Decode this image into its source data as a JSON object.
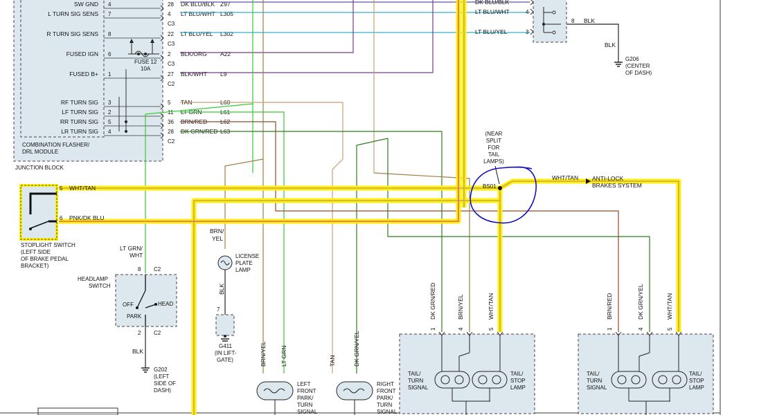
{
  "colors": {
    "highlight": "#fff200",
    "wht_tan": "#c8a070",
    "pnk_dk_blu": "#e85a8a",
    "lt_grn": "#33cc33",
    "brn_yel": "#a08040",
    "dk_grn_yel": "#2e7d1f",
    "brn_red": "#8b4a2a",
    "lt_blu": "#30b0d0",
    "circle_mark": "#1010c0"
  },
  "junction_block": {
    "title": "JUNCTION BLOCK",
    "module": {
      "line1": "COMBINATION FLASHER/",
      "line2": "DRL MODULE"
    },
    "rows": [
      {
        "label": "SW GND",
        "pin": "4",
        "cpin": "28",
        "wire": "DK BLU/BLK",
        "circuit": "Z97",
        "conn": ""
      },
      {
        "label": "L TURN SIG SENS",
        "pin": "7",
        "cpin": "4",
        "wire": "LT BLU/WHT",
        "circuit": "L305",
        "conn": "C3"
      },
      {
        "label": "R TURN SIG SENS",
        "pin": "8",
        "cpin": "22",
        "wire": "LT BLU/YEL",
        "circuit": "L302",
        "conn": "C3"
      },
      {
        "label": "FUSED IGN",
        "pin": "6",
        "cpin": "2",
        "wire": "BLK/ORG",
        "circuit": "A22",
        "conn": "C3"
      },
      {
        "label": "FUSED B+",
        "pin": "1",
        "cpin": "27",
        "wire": "BLK/WHT",
        "circuit": "L9",
        "conn": "C2"
      },
      {
        "label": "RF TURN SIG",
        "pin": "3",
        "cpin": "5",
        "wire": "TAN",
        "circuit": "L60",
        "conn": ""
      },
      {
        "label": "LF TURN SIG",
        "pin": "2",
        "cpin": "11",
        "wire": "LT GRN",
        "circuit": "L61",
        "conn": ""
      },
      {
        "label": "RR TURN SIG",
        "pin": "5",
        "cpin": "36",
        "wire": "BRN/RED",
        "circuit": "L62",
        "conn": ""
      },
      {
        "label": "LR TURN SIG",
        "pin": "4",
        "cpin": "28",
        "wire": "DK GRN/RED",
        "circuit": "L63",
        "conn": "C2"
      }
    ],
    "fuse": {
      "name": "FUSE 12",
      "rating": "10A"
    }
  },
  "right_switch": {
    "rows": [
      {
        "wire": "DK BLU/BLK",
        "pin": ""
      },
      {
        "wire": "LT BLU/WHT",
        "pin": "4"
      },
      {
        "wire": "LT BLU/YEL",
        "pin": "3"
      }
    ],
    "out_pin": "8",
    "out_wire": "BLK",
    "ground_wire": "BLK",
    "ground": {
      "id": "G206",
      "line1": "(CENTER",
      "line2": "OF DASH)"
    }
  },
  "stoplight_switch": {
    "pin5": "5",
    "wire5": "WHT/TAN",
    "pin6": "6",
    "wire6": "PNK/DK BLU",
    "title": [
      "STOPLIGHT SWITCH",
      "(LEFT SIDE",
      "OF BRAKE PEDAL",
      "BRACKET)"
    ]
  },
  "splice": {
    "id": "BS01",
    "note": [
      "(NEAR",
      "SPLIT",
      "FOR",
      "TAIL",
      "LAMPS)"
    ],
    "out_wire": "WHT/TAN",
    "dest": [
      "ANTI-LOCK",
      "BRAKES SYSTEM"
    ]
  },
  "headlamp_switch": {
    "title": [
      "HEADLAMP",
      "SWITCH"
    ],
    "wire_in": [
      "LT GRN/",
      "WHT"
    ],
    "pin_top": "8",
    "conn_top": "C2",
    "pin_bot": "2",
    "conn_bot": "C2",
    "off": "OFF",
    "park": "PARK",
    "head": "HEAD",
    "wire_out": "BLK",
    "ground": {
      "id": "G202",
      "lines": [
        "(LEFT",
        "SIDE OF",
        "DASH)"
      ]
    }
  },
  "license_lamp": {
    "wire_in": [
      "BRN/",
      "YEL"
    ],
    "title": [
      "LICENSE",
      "PLATE",
      "LAMP"
    ],
    "wire_out": "BLK",
    "pin": "7",
    "ground": {
      "id": "G411",
      "lines": [
        "(IN LIFT-",
        "GATE)"
      ]
    }
  },
  "left_front": {
    "wires": [
      "BRN/YEL",
      "LT GRN"
    ],
    "title": [
      "LEFT",
      "FRONT",
      "PARK/",
      "TURN",
      "SIGNAL"
    ]
  },
  "right_front": {
    "wires": [
      "TAN",
      "DK GRN/YEL"
    ],
    "title": [
      "RIGHT",
      "FRONT",
      "PARK/",
      "TURN",
      "SIGNAL"
    ]
  },
  "left_rear": {
    "pins": [
      "1",
      "4",
      "5"
    ],
    "wires": [
      "DK GRN/RED",
      "BRN/YEL",
      "WHT/TAN"
    ],
    "left_title": [
      "TAIL/",
      "TURN",
      "SIGNAL"
    ],
    "right_title": [
      "TAIL/",
      "STOP",
      "LAMP"
    ]
  },
  "right_rear": {
    "pins": [
      "1",
      "4",
      "5"
    ],
    "wires": [
      "BRN/RED",
      "DK GRN/YEL",
      "WHT/TAN"
    ],
    "left_title": [
      "TAIL/",
      "TURN",
      "SIGNAL"
    ],
    "right_title": [
      "TAIL/",
      "STOP",
      "LAMP"
    ]
  }
}
